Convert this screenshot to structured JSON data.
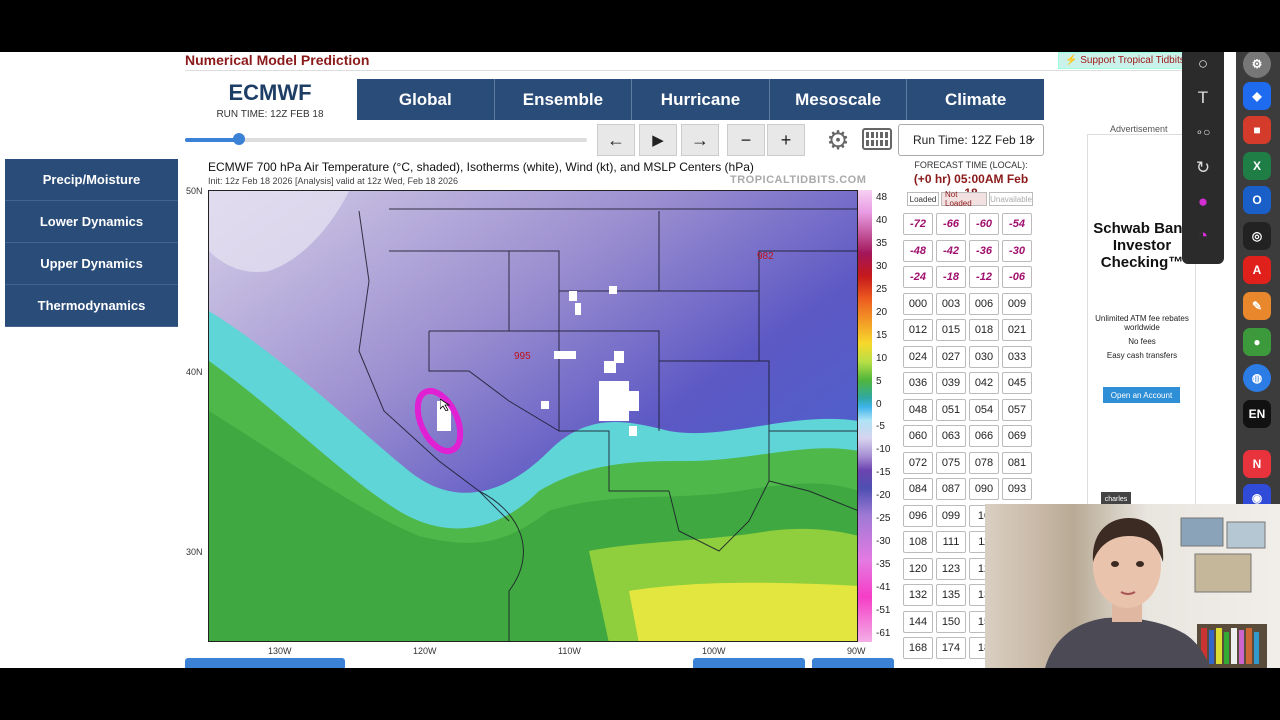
{
  "header": {
    "title": "Numerical Model Prediction",
    "support_link": "⚡ Support Tropical Tidbits ⚡"
  },
  "model": {
    "name": "ECMWF",
    "run_time": "RUN TIME: 12Z FEB 18"
  },
  "tabs": [
    "Global",
    "Ensemble",
    "Hurricane",
    "Mesoscale",
    "Climate"
  ],
  "controls": {
    "back": "←",
    "play": "▶",
    "forward": "→",
    "minus": "−",
    "plus": "+",
    "run_select": "Run Time: 12Z Feb 18",
    "slider_fraction": 0.135
  },
  "sidebar": {
    "items": [
      "Precip/Moisture",
      "Lower Dynamics",
      "Upper Dynamics",
      "Thermodynamics"
    ]
  },
  "map": {
    "title": "ECMWF 700 hPa Air Temperature (°C, shaded), Isotherms (white), Wind (kt), and MSLP Centers (hPa)",
    "subtitle": "Init: 12z Feb 18 2026   [Analysis]   valid at 12z Wed, Feb 18 2026",
    "watermark": "TROPICALTIDBITS.COM",
    "lat_labels": [
      "50N",
      "40N",
      "30N"
    ],
    "lon_labels": [
      "130W",
      "120W",
      "110W",
      "100W",
      "90W"
    ],
    "pressure_centers": [
      "982",
      "995"
    ],
    "colorbar_ticks": [
      "48",
      "40",
      "35",
      "30",
      "25",
      "20",
      "15",
      "10",
      "5",
      "0",
      "-5",
      "-10",
      "-15",
      "-20",
      "-25",
      "-30",
      "-35",
      "-41",
      "-51",
      "-61"
    ]
  },
  "forecast": {
    "header": "FORECAST TIME (LOCAL):",
    "time": "(+0 hr) 05:00AM Feb 18",
    "legend": [
      "Loaded",
      "Not Loaded",
      "Unavailable"
    ],
    "hours": [
      [
        "-72",
        "-66",
        "-60",
        "-54"
      ],
      [
        "-48",
        "-42",
        "-36",
        "-30"
      ],
      [
        "-24",
        "-18",
        "-12",
        "-06"
      ],
      [
        "000",
        "003",
        "006",
        "009"
      ],
      [
        "012",
        "015",
        "018",
        "021"
      ],
      [
        "024",
        "027",
        "030",
        "033"
      ],
      [
        "036",
        "039",
        "042",
        "045"
      ],
      [
        "048",
        "051",
        "054",
        "057"
      ],
      [
        "060",
        "063",
        "066",
        "069"
      ],
      [
        "072",
        "075",
        "078",
        "081"
      ],
      [
        "084",
        "087",
        "090",
        "093"
      ],
      [
        "096",
        "099",
        "10",
        ""
      ],
      [
        "108",
        "111",
        "11",
        ""
      ],
      [
        "120",
        "123",
        "12",
        ""
      ],
      [
        "132",
        "135",
        "13",
        ""
      ],
      [
        "144",
        "150",
        "15",
        ""
      ],
      [
        "168",
        "174",
        "18",
        ""
      ]
    ]
  },
  "ad": {
    "label": "Advertisement",
    "brand": "Schwab Bank Investor Checking™",
    "lines": [
      "Unlimited ATM fee rebates worldwide",
      "No fees",
      "Easy cash transfers"
    ],
    "cta": "Open an Account",
    "logo": "charles"
  },
  "tools": [
    "○",
    "T",
    "∘○",
    "↻",
    "●",
    "◔"
  ],
  "dock": {
    "lang": "EN"
  },
  "colors": {
    "nav": "#2a4c78",
    "accent": "#3b82d6",
    "title_red": "#8b1a1a",
    "highlight": "#e021d3"
  }
}
